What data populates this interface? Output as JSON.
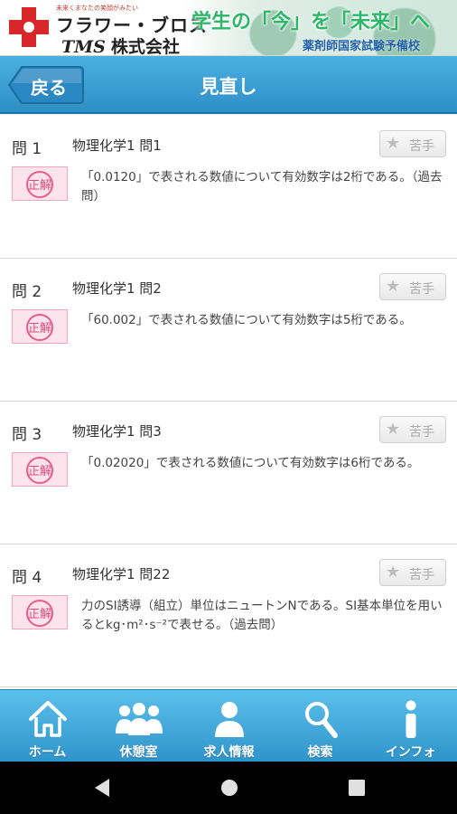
{
  "banner": {
    "tagline": "未来くまなたの笑顔がみたい",
    "brand": "フラワー・ブロス",
    "company_prefix": "TMS",
    "company": "株式会社",
    "slogan": "学生の「今」を「未来」へ",
    "school": "薬剤師国家試験予備校"
  },
  "header": {
    "back_label": "戻る",
    "title": "見直し"
  },
  "questions": [
    {
      "num": "問 1",
      "subject": "物理化学1 問1",
      "badge": "正解",
      "text": "「0.0120」で表される数値について有効数字は2桁である。（過去問）",
      "weak_label": "苦手"
    },
    {
      "num": "問 2",
      "subject": "物理化学1 問2",
      "badge": "正解",
      "text": "「60.002」で表される数値について有効数字は5桁である。",
      "weak_label": "苦手"
    },
    {
      "num": "問 3",
      "subject": "物理化学1 問3",
      "badge": "正解",
      "text": "「0.02020」で表される数値について有効数字は6桁である。",
      "weak_label": "苦手"
    },
    {
      "num": "問 4",
      "subject": "物理化学1 問22",
      "badge": "正解",
      "text": "力のSI誘導（組立）単位はニュートンNである。SI基本単位を用いるとkg･m²･s⁻²で表せる。（過去問）",
      "weak_label": "苦手"
    }
  ],
  "tabs": [
    {
      "label": "ホーム",
      "icon": "home-icon"
    },
    {
      "label": "休憩室",
      "icon": "people-icon"
    },
    {
      "label": "求人情報",
      "icon": "person-icon"
    },
    {
      "label": "検索",
      "icon": "search-icon"
    },
    {
      "label": "インフォ",
      "icon": "info-icon"
    }
  ],
  "colors": {
    "header": "#3aa0d6",
    "correct_badge": "#ea5d8a",
    "tabbar": "#4ab0e3"
  }
}
